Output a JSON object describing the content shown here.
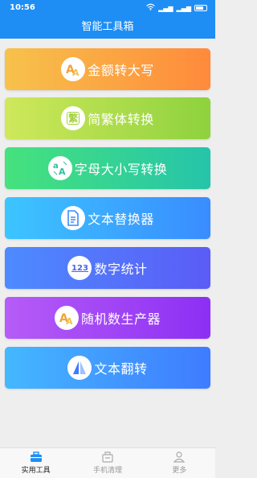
{
  "status_bar": {
    "time": "10:56"
  },
  "header": {
    "title": "智能工具箱"
  },
  "tools": [
    {
      "label": "金额转大写",
      "icon": "money-uppercase-icon",
      "icon_text": "A"
    },
    {
      "label": "简繁体转换",
      "icon": "simplified-traditional-icon",
      "icon_text": "繁"
    },
    {
      "label": "字母大小写转换",
      "icon": "letter-case-icon",
      "icon_text": "aA"
    },
    {
      "label": "文本替换器",
      "icon": "text-replace-icon",
      "icon_text": "≡"
    },
    {
      "label": "数字统计",
      "icon": "number-count-icon",
      "icon_text": "123"
    },
    {
      "label": "随机数生产器",
      "icon": "random-number-icon",
      "icon_text": "A"
    },
    {
      "label": "文本翻转",
      "icon": "text-flip-icon",
      "icon_text": "◭"
    }
  ],
  "tabbar": {
    "items": [
      {
        "label": "实用工具",
        "active": true
      },
      {
        "label": "手机清理",
        "active": false
      },
      {
        "label": "更多",
        "active": false
      }
    ]
  }
}
